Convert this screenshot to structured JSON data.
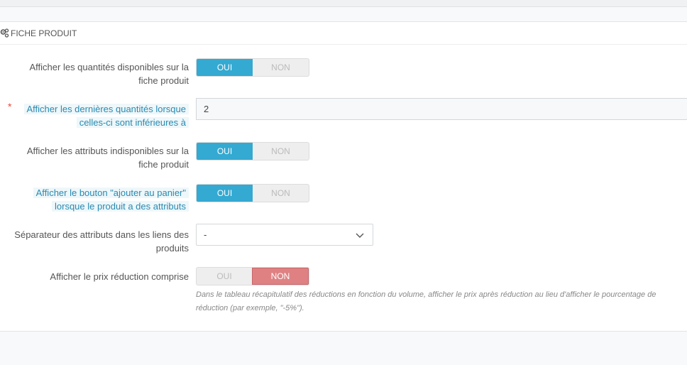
{
  "panel": {
    "heading": "FICHE PRODUIT",
    "heading_icon": "cogs-icon"
  },
  "switch_labels": {
    "yes": "OUI",
    "no": "NON"
  },
  "fields": {
    "show_quantities": {
      "label_line1": "Afficher les quantités disponibles sur la",
      "label_line2": "fiche produit",
      "value": "OUI"
    },
    "last_quantities": {
      "required_mark": "*",
      "label_line1": "Afficher les dernières quantités lorsque",
      "label_line2": "celles-ci sont inférieures à",
      "value": "2"
    },
    "unavailable_attributes": {
      "label_line1": "Afficher les attributs indisponibles sur la",
      "label_line2": "fiche produit",
      "value": "OUI"
    },
    "add_to_cart": {
      "label_line1": "Afficher le bouton \"ajouter au panier\"",
      "label_line2": "lorsque le produit a des attributs",
      "value": "OUI"
    },
    "attribute_separator": {
      "label_line1": "Séparateur des attributs dans les liens des",
      "label_line2": "produits",
      "value": "-"
    },
    "discounted_price": {
      "label": "Afficher le prix réduction comprise",
      "value": "NON",
      "help_line1": "Dans le tableau récapitulatif des réductions en fonction du volume, afficher le prix après réduction au lieu d'afficher le pourcentage de",
      "help_line2": "réduction (par exemple, \"-5%\")."
    }
  },
  "colors": {
    "accent": "#34a9d1",
    "no_active": "#df8183",
    "required": "#e74c3c"
  }
}
